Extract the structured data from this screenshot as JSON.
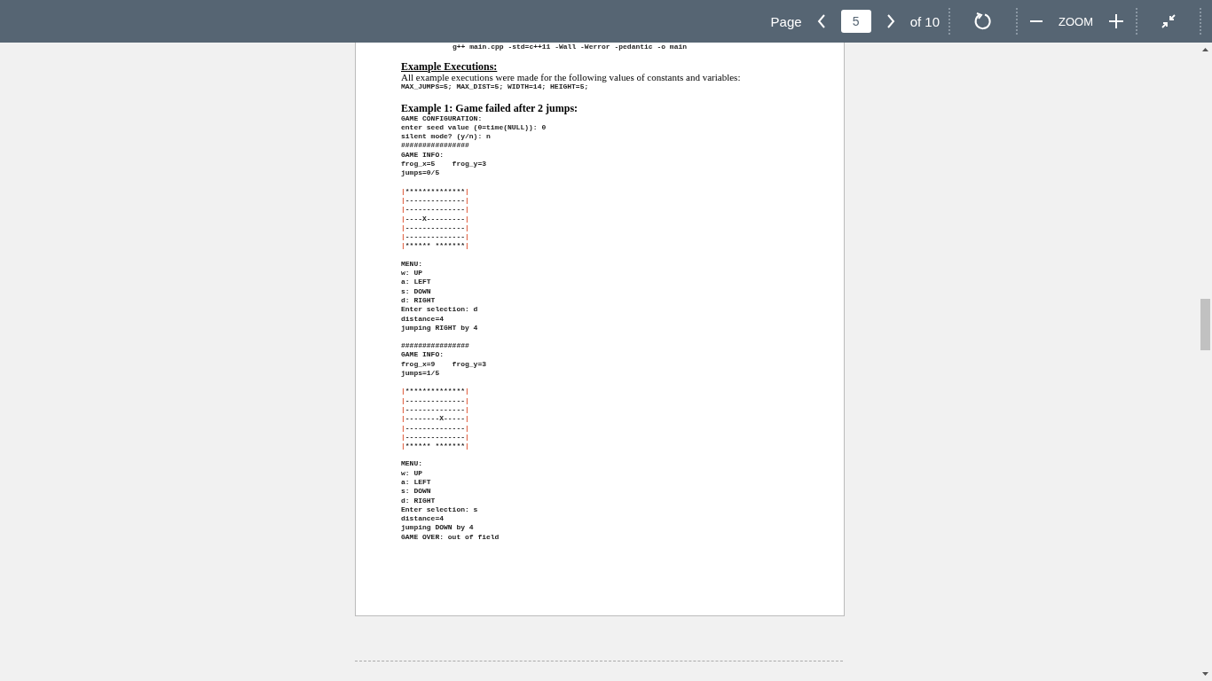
{
  "toolbar": {
    "page_label": "Page",
    "page_value": "5",
    "page_count": "of 10",
    "zoom_label": "ZOOM"
  },
  "document": {
    "command": "g++ main.cpp -std=c++11 -Wall -Werror -pedantic -o main",
    "section_heading": "Example Executions:",
    "intro": "All example executions were made for the following values of constants and variables:",
    "constants": "MAX_JUMPS=5; MAX_DIST=5; WIDTH=14; HEIGHT=5;",
    "example_heading": "Example 1: Game failed after 2 jumps:",
    "blocks": [
      {
        "kind": "text",
        "lines": [
          "GAME CONFIGURATION:",
          "enter seed value (0=time(NULL)): 0",
          "silent mode? (y/n): n",
          "################",
          "GAME INFO:",
          "frog_x=5    frog_y=3",
          "jumps=0/5"
        ]
      },
      {
        "kind": "board",
        "lines": [
          "|**************|",
          "|--------------|",
          "|--------------|",
          "|----X---------|",
          "|--------------|",
          "|--------------|",
          "|****** *******|"
        ]
      },
      {
        "kind": "text",
        "lines": [
          "MENU:",
          "w: UP",
          "a: LEFT",
          "s: DOWN",
          "d: RIGHT",
          "Enter selection: d",
          "distance=4",
          "jumping RIGHT by 4"
        ]
      },
      {
        "kind": "text",
        "lines": [
          "################",
          "GAME INFO:",
          "frog_x=9    frog_y=3",
          "jumps=1/5"
        ]
      },
      {
        "kind": "board",
        "lines": [
          "|**************|",
          "|--------------|",
          "|--------------|",
          "|--------X-----|",
          "|--------------|",
          "|--------------|",
          "|****** *******|"
        ]
      },
      {
        "kind": "text",
        "lines": [
          "MENU:",
          "w: UP",
          "a: LEFT",
          "s: DOWN",
          "d: RIGHT",
          "Enter selection: s",
          "distance=4",
          "jumping DOWN by 4",
          "GAME OVER: out of field"
        ]
      }
    ]
  }
}
